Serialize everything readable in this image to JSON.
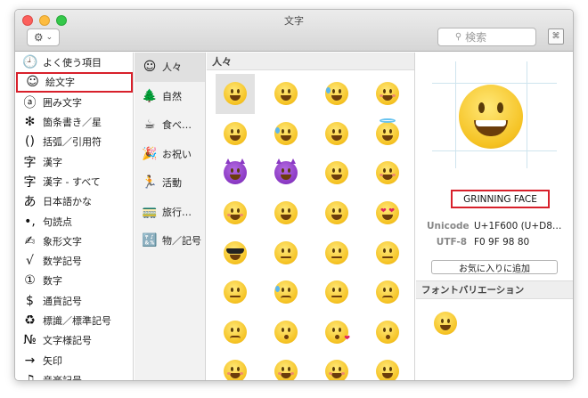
{
  "window": {
    "title": "文字"
  },
  "toolbar": {
    "gear_label": "⚙",
    "gear_chevron": "⌄",
    "search_placeholder": "検索",
    "search_icon": "🔍",
    "keyboard_icon": "⌘"
  },
  "sidebar": {
    "items": [
      {
        "icon": "🕘",
        "label": "よく使う項目"
      },
      {
        "icon": "☺",
        "label": "絵文字"
      },
      {
        "icon": "ⓐ",
        "label": "囲み文字"
      },
      {
        "icon": "✻",
        "label": "箇条書き／星"
      },
      {
        "icon": "()",
        "label": "括弧／引用符"
      },
      {
        "icon": "字",
        "label": "漢字"
      },
      {
        "icon": "字",
        "label": "漢字 - すべて"
      },
      {
        "icon": "あ",
        "label": "日本語かな"
      },
      {
        "icon": "•,",
        "label": "句読点"
      },
      {
        "icon": "✍",
        "label": "象形文字"
      },
      {
        "icon": "√",
        "label": "数学記号"
      },
      {
        "icon": "①",
        "label": "数字"
      },
      {
        "icon": "$",
        "label": "通貨記号"
      },
      {
        "icon": "♻",
        "label": "標識／標準記号"
      },
      {
        "icon": "№",
        "label": "文字様記号"
      },
      {
        "icon": "→",
        "label": "矢印"
      },
      {
        "icon": "♫",
        "label": "音楽記号"
      }
    ]
  },
  "subcategories": [
    {
      "icon": "☺",
      "label": "人々"
    },
    {
      "icon": "🌲",
      "label": "自然"
    },
    {
      "icon": "☕",
      "label": "食べ…"
    },
    {
      "icon": "🎉",
      "label": "お祝い"
    },
    {
      "icon": "🏃",
      "label": "活動"
    },
    {
      "icon": "🚃",
      "label": "旅行…"
    },
    {
      "icon": "🔣",
      "label": "物／記号"
    }
  ],
  "grid": {
    "header": "人々"
  },
  "preview": {
    "name": "GRINNING FACE",
    "unicode_label": "Unicode",
    "unicode_value": "U+1F600 (U+D8…",
    "utf8_label": "UTF-8",
    "utf8_value": "F0 9F 98 80",
    "favorite_button": "お気に入りに追加"
  },
  "font_variation": {
    "header": "フォントバリエーション"
  },
  "colors": {
    "selection_outline": "#d8202b",
    "emoji_yellow": "#f5c222",
    "devil_purple": "#8a39c4"
  }
}
